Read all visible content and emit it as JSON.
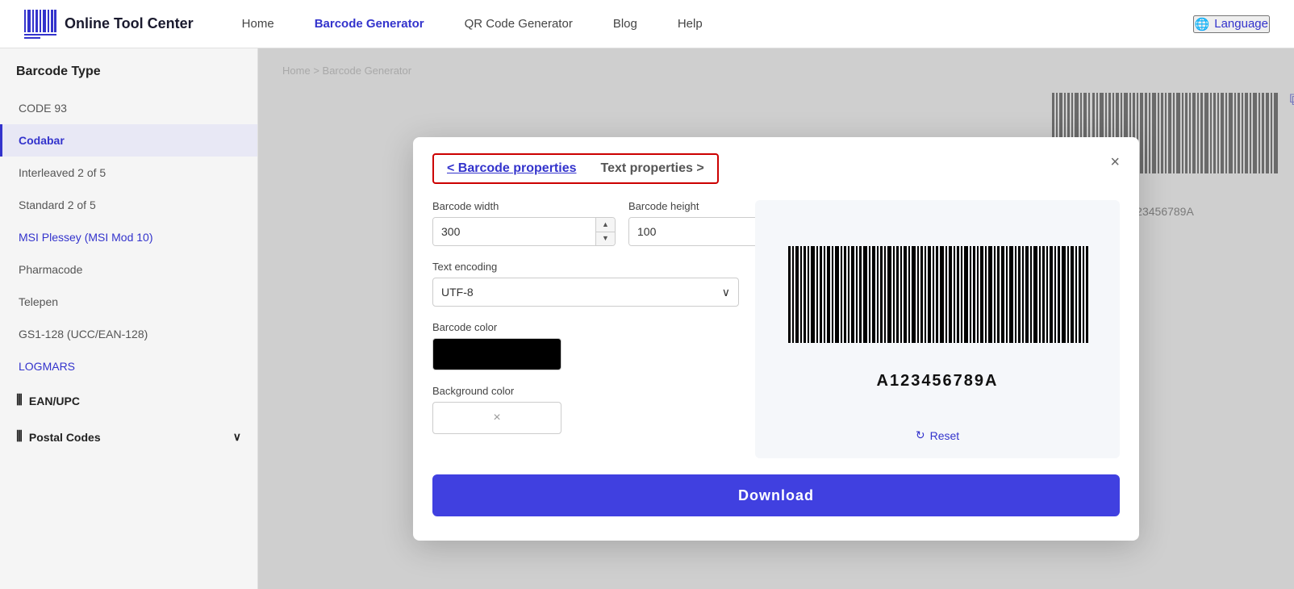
{
  "header": {
    "logo_text": "Online Tool Center",
    "nav": [
      {
        "label": "Home",
        "active": false
      },
      {
        "label": "Barcode Generator",
        "active": true
      },
      {
        "label": "QR Code Generator",
        "active": false
      },
      {
        "label": "Blog",
        "active": false
      },
      {
        "label": "Help",
        "active": false
      }
    ],
    "language_label": "Language"
  },
  "breadcrumb": {
    "home": "Home",
    "separator": ">",
    "current": "Barcode Generator"
  },
  "sidebar": {
    "title": "Barcode Type",
    "items": [
      {
        "label": "CODE 93",
        "active": false,
        "color": "default"
      },
      {
        "label": "Codabar",
        "active": true,
        "color": "blue"
      },
      {
        "label": "Interleaved 2 of 5",
        "active": false,
        "color": "default"
      },
      {
        "label": "Standard 2 of 5",
        "active": false,
        "color": "default"
      },
      {
        "label": "MSI Plessey (MSI Mod 10)",
        "active": false,
        "color": "blue"
      },
      {
        "label": "Pharmacode",
        "active": false,
        "color": "default"
      },
      {
        "label": "Telepen",
        "active": false,
        "color": "default"
      },
      {
        "label": "GS1-128 (UCC/EAN-128)",
        "active": false,
        "color": "default"
      },
      {
        "label": "LOGMARS",
        "active": false,
        "color": "blue"
      }
    ],
    "groups": [
      {
        "label": "EAN/UPC"
      },
      {
        "label": "Postal Codes"
      }
    ]
  },
  "modal": {
    "tabs": [
      {
        "label": "< Barcode properties",
        "active": true
      },
      {
        "label": "Text properties >",
        "active": false
      }
    ],
    "close_label": "×",
    "fields": {
      "barcode_width_label": "Barcode width",
      "barcode_width_value": "300",
      "barcode_height_label": "Barcode height",
      "barcode_height_value": "100",
      "text_encoding_label": "Text encoding",
      "text_encoding_value": "UTF-8",
      "barcode_color_label": "Barcode color",
      "background_color_label": "Background color",
      "bg_color_clear": "×"
    },
    "preview": {
      "barcode_label": "A123456789A"
    },
    "reset_label": "Reset",
    "download_label": "Download"
  },
  "bg_barcode": {
    "label": "23456789A"
  },
  "icons": {
    "barcode": "|||",
    "globe": "🌐",
    "copy": "⧉",
    "refresh": "↻",
    "chevron_down": "∨",
    "postal_chevron": "∨",
    "arrow_left": "<",
    "arrow_right": ">"
  }
}
